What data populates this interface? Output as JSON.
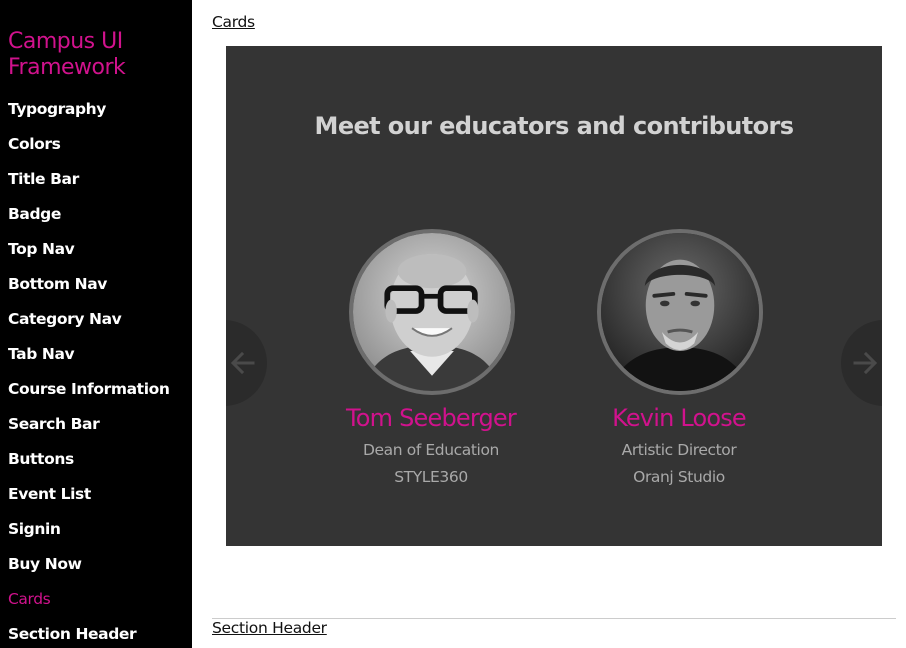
{
  "colors": {
    "accent": "#d1128d",
    "sidebar_text": "#ffffff",
    "sidebar_bg": "#000000",
    "panel_bg": "#343434",
    "muted_text": "#a9a9a9",
    "title_text": "#d2d2d2"
  },
  "sidebar": {
    "brand": "Campus UI Framework",
    "items": [
      {
        "label": "Typography",
        "active": false
      },
      {
        "label": "Colors",
        "active": false
      },
      {
        "label": "Title Bar",
        "active": false
      },
      {
        "label": "Badge",
        "active": false
      },
      {
        "label": "Top Nav",
        "active": false
      },
      {
        "label": "Bottom Nav",
        "active": false
      },
      {
        "label": "Category Nav",
        "active": false
      },
      {
        "label": "Tab Nav",
        "active": false
      },
      {
        "label": "Course Information",
        "active": false
      },
      {
        "label": "Search Bar",
        "active": false
      },
      {
        "label": "Buttons",
        "active": false
      },
      {
        "label": "Event List",
        "active": false
      },
      {
        "label": "Signin",
        "active": false
      },
      {
        "label": "Buy Now",
        "active": false
      },
      {
        "label": "Cards",
        "active": true
      },
      {
        "label": "Section Header",
        "active": false
      }
    ]
  },
  "main": {
    "section_link": "Cards",
    "next_section_link": "Section Header",
    "panel": {
      "title": "Meet our educators and contributors",
      "prev_icon": "arrow-left-icon",
      "next_icon": "arrow-right-icon",
      "cards": [
        {
          "name": "Tom Seeberger",
          "role": "Dean of Education",
          "org": "STYLE360"
        },
        {
          "name": "Kevin Loose",
          "role": "Artistic Director",
          "org": "Oranj Studio"
        }
      ]
    }
  }
}
